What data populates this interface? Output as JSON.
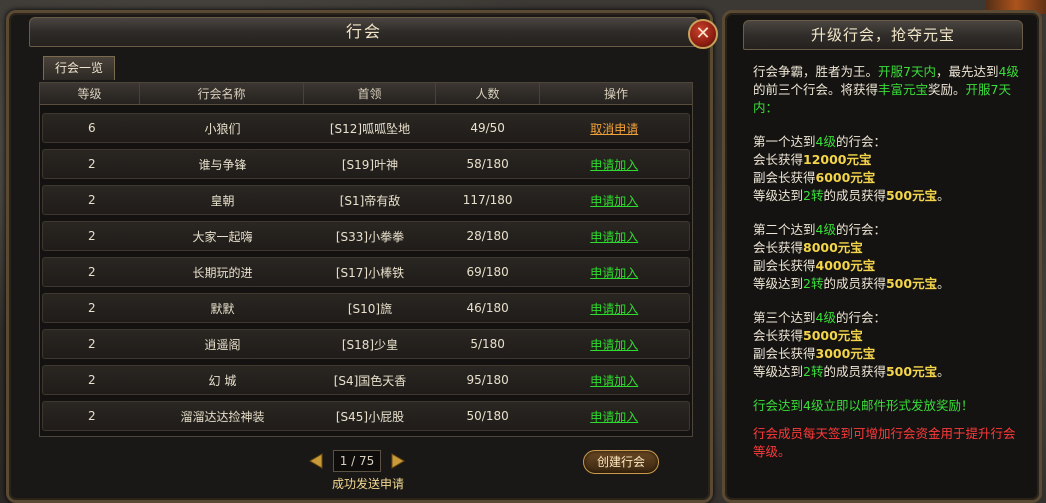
{
  "panel": {
    "title": "行会",
    "close_symbol": "✕",
    "tab_label": "行会一览"
  },
  "table": {
    "headers": [
      "等级",
      "行会名称",
      "首领",
      "人数",
      "操作"
    ],
    "rows": [
      {
        "level": "6",
        "name": "小狼们",
        "leader": "[S12]呱呱坠地",
        "members": "49/50",
        "action": "取消申请",
        "action_type": "cancel"
      },
      {
        "level": "2",
        "name": "谁与争锋",
        "leader": "[S19]叶神",
        "members": "58/180",
        "action": "申请加入",
        "action_type": "join"
      },
      {
        "level": "2",
        "name": "皇朝",
        "leader": "[S1]帝有敌",
        "members": "117/180",
        "action": "申请加入",
        "action_type": "join"
      },
      {
        "level": "2",
        "name": "大家一起嗨",
        "leader": "[S33]小拳拳",
        "members": "28/180",
        "action": "申请加入",
        "action_type": "join"
      },
      {
        "level": "2",
        "name": "长期玩的进",
        "leader": "[S17]小棒铁",
        "members": "69/180",
        "action": "申请加入",
        "action_type": "join"
      },
      {
        "level": "2",
        "name": "默默",
        "leader": "[S10]旒",
        "members": "46/180",
        "action": "申请加入",
        "action_type": "join"
      },
      {
        "level": "2",
        "name": "逍遥阁",
        "leader": "[S18]少皇",
        "members": "5/180",
        "action": "申请加入",
        "action_type": "join"
      },
      {
        "level": "2",
        "name": "幻 城",
        "leader": "[S4]国色天香",
        "members": "95/180",
        "action": "申请加入",
        "action_type": "join"
      },
      {
        "level": "2",
        "name": "溜溜达达捡神装",
        "leader": "[S45]小屁股",
        "members": "50/180",
        "action": "申请加入",
        "action_type": "join"
      }
    ]
  },
  "pager": {
    "page": "1 / 75"
  },
  "status_message": "成功发送申请",
  "create_button": "创建行会",
  "side": {
    "title": "升级行会，抢夺元宝",
    "intro": {
      "t1": "行会争霸，胜者为王。",
      "t2": "开服7天内",
      "t3": "，最先达到",
      "t4": "4级",
      "t5": "的前三个行会。将获得",
      "t6": "丰富元宝",
      "t7": "奖励。",
      "t8": "开服7天内："
    },
    "tiers": [
      {
        "head_a": "第一个达到",
        "head_lv": "4级",
        "head_b": "的行会：",
        "leader_a": "会长获得",
        "leader_amt": "12000元宝",
        "vice_a": "副会长获得",
        "vice_amt": "6000元宝",
        "mem_a": "等级达到",
        "mem_lv": "2转",
        "mem_b": "的成员获得",
        "mem_amt": "500元宝",
        "mem_c": "。"
      },
      {
        "head_a": "第二个达到",
        "head_lv": "4级",
        "head_b": "的行会：",
        "leader_a": "会长获得",
        "leader_amt": "8000元宝",
        "vice_a": "副会长获得",
        "vice_amt": "4000元宝",
        "mem_a": "等级达到",
        "mem_lv": "2转",
        "mem_b": "的成员获得",
        "mem_amt": "500元宝",
        "mem_c": "。"
      },
      {
        "head_a": "第三个达到",
        "head_lv": "4级",
        "head_b": "的行会：",
        "leader_a": "会长获得",
        "leader_amt": "5000元宝",
        "vice_a": "副会长获得",
        "vice_amt": "3000元宝",
        "mem_a": "等级达到",
        "mem_lv": "2转",
        "mem_b": "的成员获得",
        "mem_amt": "500元宝",
        "mem_c": "。"
      }
    ],
    "notice_green": "行会达到4级立即以邮件形式发放奖励！",
    "notice_red": "行会成员每天签到可增加行会资金用于提升行会等级。"
  },
  "colors": {
    "join_action": "#2edc2e",
    "cancel_action": "#f2a23a",
    "highlight_green": "#3ade3a",
    "highlight_gold": "#f4d54a",
    "notice_red": "#ff3a3a"
  }
}
